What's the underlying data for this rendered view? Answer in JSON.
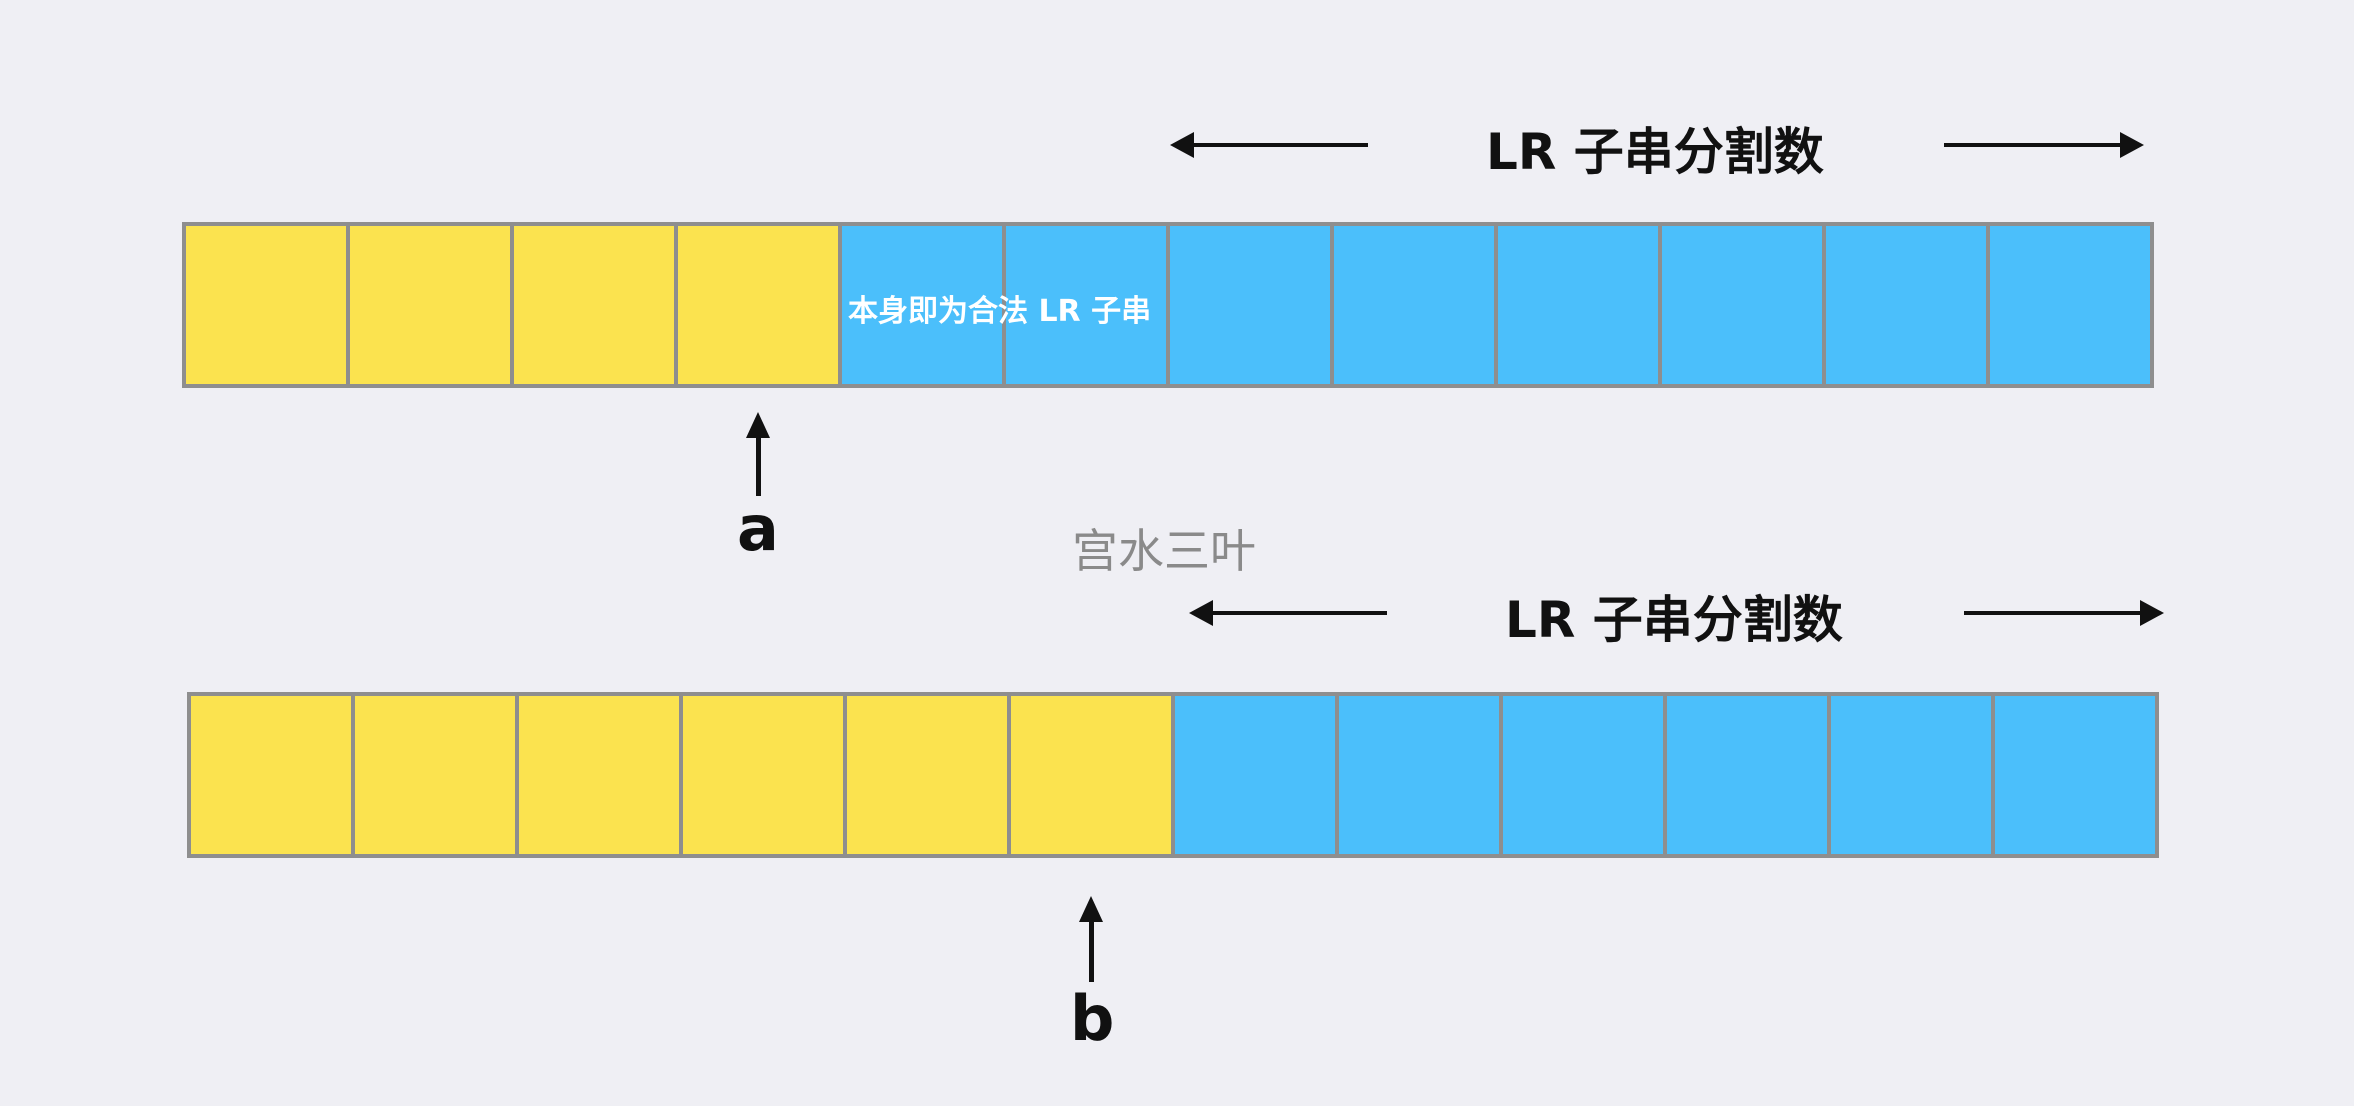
{
  "diagram": {
    "top": {
      "label": "LR 子串分割数",
      "pointer": "a",
      "inline_text": "本身即为合法 LR 子串",
      "cells": [
        "yellow",
        "yellow",
        "yellow",
        "yellow",
        "blue",
        "blue",
        "blue",
        "blue",
        "blue",
        "blue",
        "blue",
        "blue"
      ]
    },
    "bottom": {
      "label": "LR 子串分割数",
      "pointer": "b",
      "cells": [
        "yellow",
        "yellow",
        "yellow",
        "yellow",
        "yellow",
        "yellow",
        "blue",
        "blue",
        "blue",
        "blue",
        "blue",
        "blue"
      ]
    },
    "watermark": "宫水三叶"
  },
  "colors": {
    "yellow": "#fbe34f",
    "blue": "#4bbffb",
    "border": "#8e8e8e",
    "background": "#efeff4"
  }
}
